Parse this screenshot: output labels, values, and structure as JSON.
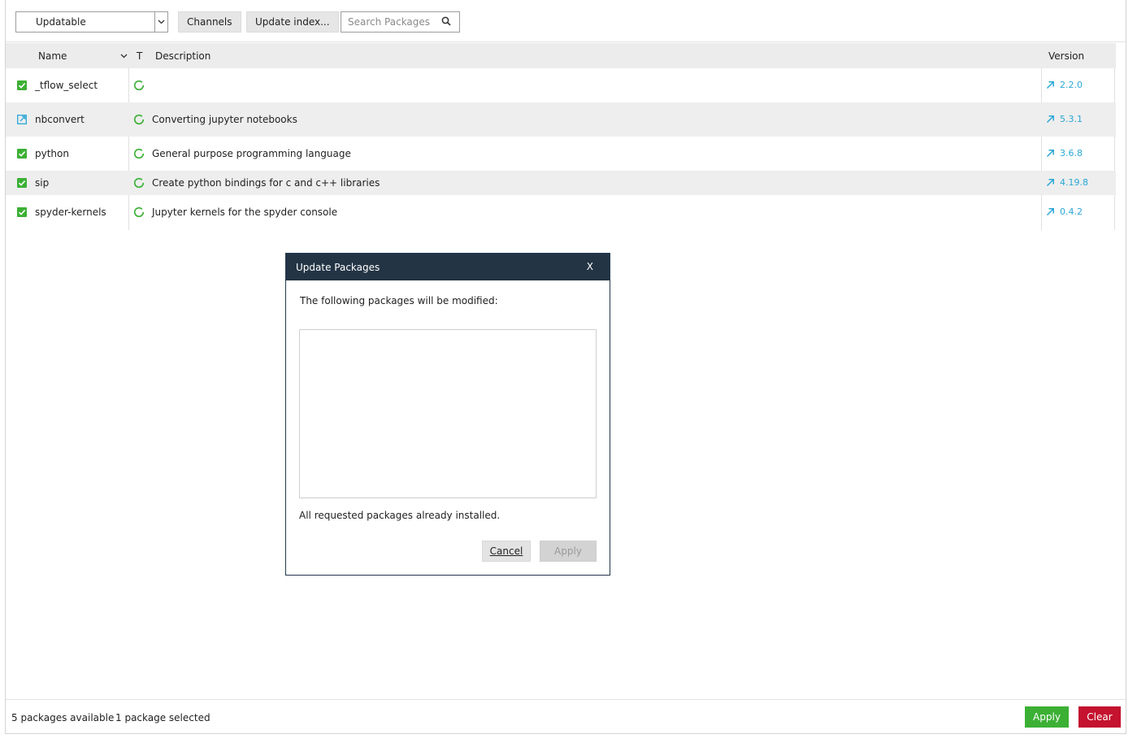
{
  "toolbar": {
    "filter_value": "Updatable",
    "channels_label": "Channels",
    "update_index_label": "Update index...",
    "search_placeholder": "Search Packages"
  },
  "table": {
    "columns": {
      "name": "Name",
      "type": "T",
      "description": "Description",
      "version": "Version"
    },
    "rows": [
      {
        "name": "_tflow_select",
        "description": "",
        "version": "2.2.0",
        "status": "checked"
      },
      {
        "name": "nbconvert",
        "description": "Converting jupyter notebooks",
        "version": "5.3.1",
        "status": "marked-update"
      },
      {
        "name": "python",
        "description": "General purpose programming language",
        "version": "3.6.8",
        "status": "checked"
      },
      {
        "name": "sip",
        "description": "Create python bindings for c and c++ libraries",
        "version": "4.19.8",
        "status": "checked"
      },
      {
        "name": "spyder-kernels",
        "description": "Jupyter kernels for the spyder console",
        "version": "0.4.2",
        "status": "checked"
      }
    ]
  },
  "dialog": {
    "title": "Update Packages",
    "close_label": "X",
    "message": "The following packages will be modified:",
    "status": "All requested packages already installed.",
    "cancel_label": "Cancel",
    "apply_label": "Apply"
  },
  "footer": {
    "available": "5 packages available",
    "selected": "1 package selected",
    "apply_label": "Apply",
    "clear_label": "Clear"
  },
  "colors": {
    "accent_green": "#3cb035",
    "accent_red": "#c4122f",
    "version_link": "#2ba7d6",
    "dialog_header": "#233445"
  }
}
